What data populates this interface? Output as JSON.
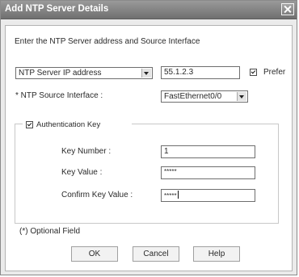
{
  "window": {
    "title": "Add NTP Server Details"
  },
  "header_text": "Enter the NTP Server address and Source Interface",
  "server": {
    "type_select": "NTP Server IP address",
    "address_value": "55.1.2.3",
    "prefer_label": "Prefer",
    "prefer_checked": true
  },
  "source": {
    "label": "* NTP Source Interface :",
    "value": "FastEthernet0/0"
  },
  "auth": {
    "label": "Authentication Key",
    "checked": true,
    "key_number_label": "Key Number :",
    "key_number_value": "1",
    "key_value_label": "Key Value :",
    "key_value_value": "*****",
    "confirm_label": "Confirm Key Value :",
    "confirm_value": "*****"
  },
  "footer_note": "(*) Optional Field",
  "buttons": {
    "ok": "OK",
    "cancel": "Cancel",
    "help": "Help"
  }
}
